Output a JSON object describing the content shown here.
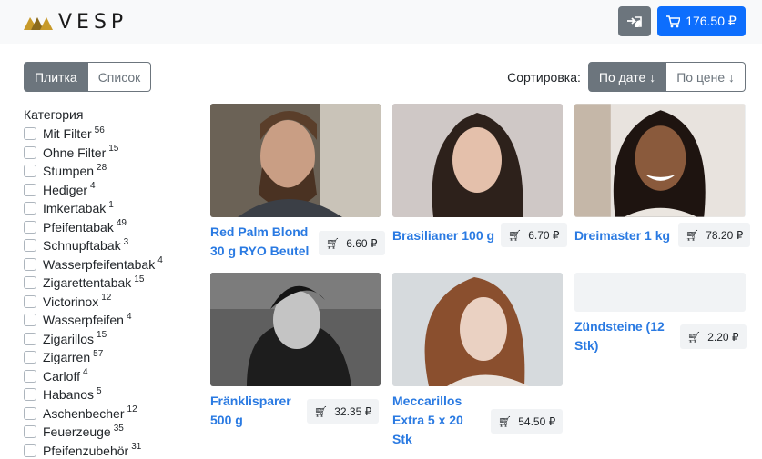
{
  "header": {
    "logo_text": "VESP",
    "cart_total": "176.50 ₽"
  },
  "view_toggle": {
    "tile_label": "Плитка",
    "list_label": "Список"
  },
  "sort": {
    "label": "Сортировка:",
    "by_date": "По дате ↓",
    "by_price": "По цене ↓"
  },
  "sidebar": {
    "title": "Категория",
    "categories": [
      {
        "name": "Mit Filter",
        "count": "56"
      },
      {
        "name": "Ohne Filter",
        "count": "15"
      },
      {
        "name": "Stumpen",
        "count": "28"
      },
      {
        "name": "Hediger",
        "count": "4"
      },
      {
        "name": "Imkertabak",
        "count": "1"
      },
      {
        "name": "Pfeifentabak",
        "count": "49"
      },
      {
        "name": "Schnupftabak",
        "count": "3"
      },
      {
        "name": "Wasserpfeifentabak",
        "count": "4"
      },
      {
        "name": "Zigarettentabak",
        "count": "15"
      },
      {
        "name": "Victorinox",
        "count": "12"
      },
      {
        "name": "Wasserpfeifen",
        "count": "4"
      },
      {
        "name": "Zigarillos",
        "count": "15"
      },
      {
        "name": "Zigarren",
        "count": "57"
      },
      {
        "name": "Carloff",
        "count": "4"
      },
      {
        "name": "Habanos",
        "count": "5"
      },
      {
        "name": "Aschenbecher",
        "count": "12"
      },
      {
        "name": "Feuerzeuge",
        "count": "35"
      },
      {
        "name": "Pfeifenzubehör",
        "count": "31"
      }
    ]
  },
  "products": [
    {
      "name": "Red Palm Blond 30 g RYO Beutel",
      "price": "6.60 ₽"
    },
    {
      "name": "Brasilianer 100 g",
      "price": "6.70 ₽"
    },
    {
      "name": "Dreimaster 1 kg",
      "price": "78.20 ₽"
    },
    {
      "name": "Fränklisparer 500 g",
      "price": "32.35 ₽"
    },
    {
      "name": "Meccarillos Extra 5 x 20 Stk",
      "price": "54.50 ₽"
    },
    {
      "name": "Zündsteine (12 Stk)",
      "price": "2.20 ₽"
    }
  ],
  "colors": {
    "primary": "#0d6efd",
    "secondary": "#6c757d",
    "link": "#2a7ae2",
    "logo_gold": "#c79a2a"
  }
}
